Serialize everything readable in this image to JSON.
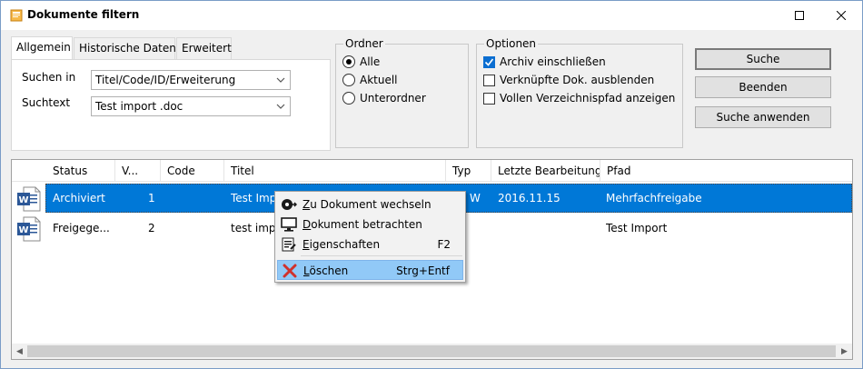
{
  "window": {
    "title": "Dokumente filtern"
  },
  "tabs": [
    {
      "label": "Allgemein",
      "active": true
    },
    {
      "label": "Historische Daten",
      "active": false
    },
    {
      "label": "Erweitert",
      "active": false
    }
  ],
  "general": {
    "search_in_label": "Suchen in",
    "search_in_value": "Titel/Code/ID/Erweiterung",
    "search_text_label": "Suchtext",
    "search_text_value": "Test import .doc"
  },
  "ordner": {
    "legend": "Ordner",
    "options": [
      {
        "label": "Alle",
        "selected": true
      },
      {
        "label": "Aktuell",
        "selected": false
      },
      {
        "label": "Unterordner",
        "selected": false
      }
    ]
  },
  "optionen": {
    "legend": "Optionen",
    "options": [
      {
        "label": "Archiv einschließen",
        "checked": true
      },
      {
        "label": "Verknüpfte Dok. ausblenden",
        "checked": false
      },
      {
        "label": "Vollen Verzeichnispfad anzeigen",
        "checked": false
      }
    ]
  },
  "buttons": {
    "search": "Suche",
    "close": "Beenden",
    "apply": "Suche anwenden"
  },
  "table": {
    "columns": [
      "Status",
      "V...",
      "Code",
      "Titel",
      "Typ",
      "Letzte Bearbeitung",
      "Pfad"
    ],
    "rows": [
      {
        "icon": "word-doc-icon",
        "status": "Archiviert",
        "version": "1",
        "code": "",
        "title": "Test Impo",
        "type": "W",
        "last_edit": "2016.11.15",
        "path": "Mehrfachfreigabe",
        "selected": true
      },
      {
        "icon": "word-doc-icon",
        "status": "Freigege...",
        "version": "2",
        "code": "",
        "title": "test impo",
        "type": "",
        "last_edit": "",
        "path": "Test Import",
        "selected": false
      }
    ]
  },
  "context_menu": {
    "items": [
      {
        "label": "Zu Dokument wechseln",
        "mnemonic": "Z",
        "rest": "u Dokument wechseln",
        "shortcut": "",
        "icon": "goto-icon"
      },
      {
        "label": "Dokument betrachten",
        "mnemonic": "D",
        "rest": "okument betrachten",
        "shortcut": "",
        "icon": "monitor-icon"
      },
      {
        "label": "Eigenschaften",
        "mnemonic": "E",
        "rest": "igenschaften",
        "shortcut": "F2",
        "icon": "properties-icon"
      },
      {
        "label": "Löschen",
        "mnemonic": "L",
        "rest": "öschen",
        "shortcut": "Strg+Entf",
        "icon": "delete-x-icon",
        "highlighted": true
      }
    ]
  },
  "colors": {
    "selection": "#0078d7",
    "menu_highlight": "#91c9f7",
    "checkbox_on": "#0b6ed1",
    "delete_red": "#d0312d",
    "word_blue": "#2b5797"
  }
}
